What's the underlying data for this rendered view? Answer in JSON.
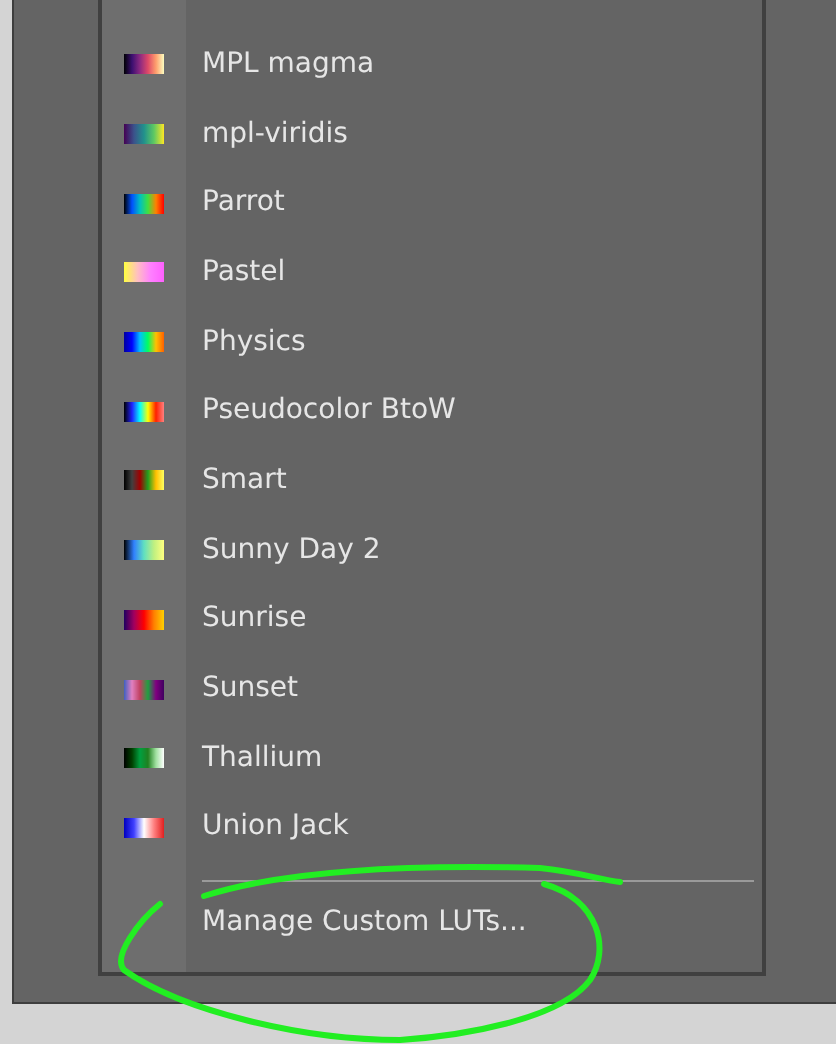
{
  "menu": {
    "items": [
      {
        "label": "MPL magma"
      },
      {
        "label": "mpl-viridis"
      },
      {
        "label": "Parrot"
      },
      {
        "label": "Pastel"
      },
      {
        "label": "Physics"
      },
      {
        "label": "Pseudocolor BtoW"
      },
      {
        "label": "Smart"
      },
      {
        "label": "Sunny Day 2"
      },
      {
        "label": "Sunrise"
      },
      {
        "label": "Sunset"
      },
      {
        "label": "Thallium"
      },
      {
        "label": "Union Jack"
      }
    ],
    "footer": "Manage Custom LUTs..."
  }
}
